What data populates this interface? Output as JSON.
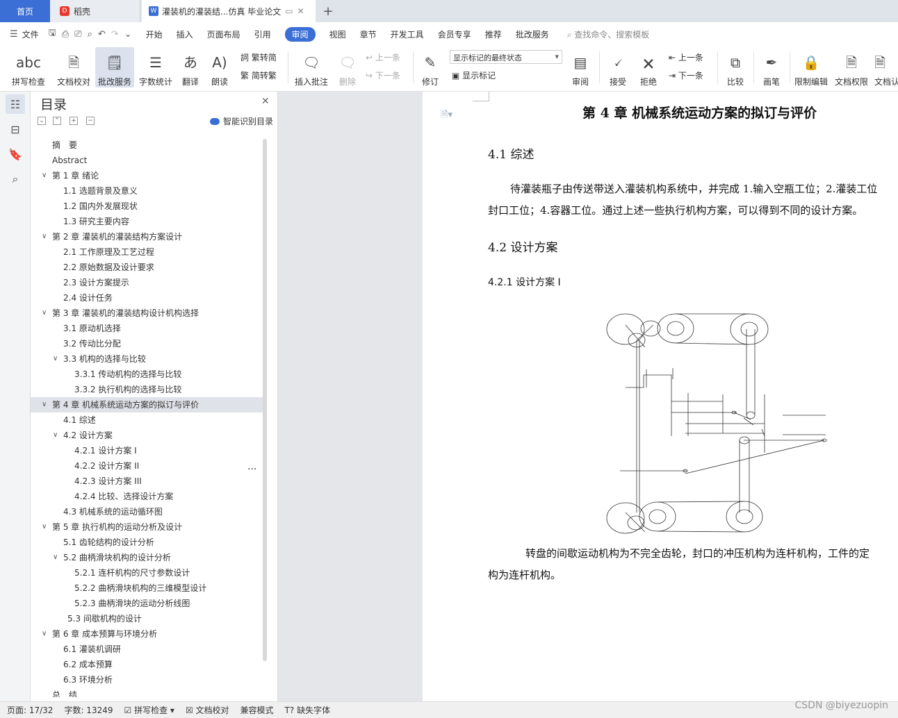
{
  "tabs": {
    "home": "首页",
    "daoke": "稻壳",
    "doc": "灌装机的灌装结...仿真 毕业论文"
  },
  "menu": {
    "file": "文件",
    "items": [
      "开始",
      "插入",
      "页面布局",
      "引用",
      "审阅",
      "视图",
      "章节",
      "开发工具",
      "会员专享",
      "推荐",
      "批改服务"
    ],
    "search": "查找命令、搜索模板"
  },
  "ribbon": {
    "spell_check": "拼写检查",
    "doc_check": "文档校对",
    "review_service": "批改服务",
    "word_count": "字数统计",
    "translate": "翻译",
    "read_aloud": "朗读",
    "trad_simp": "繁转简",
    "simp_trad": "简转繁",
    "insert_comment": "插入批注",
    "delete": "删除",
    "prev": "上一条",
    "next": "下一条",
    "revise": "修订",
    "mark_state": "显示标记的最终状态",
    "show_marks": "显示标记",
    "review": "审阅",
    "accept": "接受",
    "reject": "拒绝",
    "prev2": "上一条",
    "next2": "下一条",
    "compare": "比较",
    "pen": "画笔",
    "restrict_edit": "限制编辑",
    "doc_permission": "文档权限",
    "doc_cut": "文档认"
  },
  "toc": {
    "title": "目录",
    "smart": "智能识别目录",
    "items": [
      "摘　要",
      "Abstract",
      "第 1 章  绪论",
      "1.1 选题背景及意义",
      "1.2 国内外发展现状",
      "1.3 研究主要内容",
      "第 2 章  灌装机的灌装结构方案设计",
      "2.1 工作原理及工艺过程",
      "2.2 原始数据及设计要求",
      "2.3 设计方案提示",
      "2.4 设计任务",
      "第 3 章  灌装机的灌装结构设计机构选择",
      "3.1 原动机选择",
      "3.2 传动比分配",
      "3.3 机构的选择与比较",
      "3.3.1 传动机构的选择与比较",
      "3.3.2 执行机构的选择与比较",
      "第 4 章  机械系统运动方案的拟订与评价",
      "4.1 综述",
      "4.2 设计方案",
      "4.2.1  设计方案 I",
      "4.2.2  设计方案 II",
      "4.2.3  设计方案 III",
      "4.2.4 比较、选择设计方案",
      "4.3 机械系统的运动循环图",
      "第 5 章  执行机构的运动分析及设计",
      "5.1 齿轮结构的设计分析",
      "5.2 曲柄滑块机构的设计分析",
      "5.2.1 连杆机构的尺寸参数设计",
      "5.2.2 曲柄滑块机构的三维模型设计",
      "5.2.3  曲柄滑块的运动分析线图",
      "5.3  间歇机构的设计",
      "第 6 章  成本预算与环境分析",
      "6.1  灌装机调研",
      "6.2  成本预算",
      "6.3  环境分析",
      "总　结"
    ],
    "more": "..."
  },
  "doc": {
    "chapter_title": "第 4 章  机械系统运动方案的拟订与评价",
    "s41": "4.1 综述",
    "p1_line1": "待灌装瓶子由传送带送入灌装机构系统中，并完成 1.输入空瓶工位；2.灌装工位",
    "p1_line2": "封口工位；4.容器工位。通过上述一些执行机构方案，可以得到不同的设计方案。",
    "s42": "4.2 设计方案",
    "s421": "4.2.1  设计方案 I",
    "p2_line1": "转盘的间歇运动机构为不完全齿轮，封口的冲压机构为连杆机构，工件的定",
    "p2_line2": "构为连杆机构。"
  },
  "status": {
    "page": "页面: 17/32",
    "words": "字数: 13249",
    "spell": "拼写检查",
    "proof": "文档校对",
    "compat": "兼容模式",
    "missing_font": "缺失字体"
  },
  "watermark": "CSDN @biyezuopin"
}
